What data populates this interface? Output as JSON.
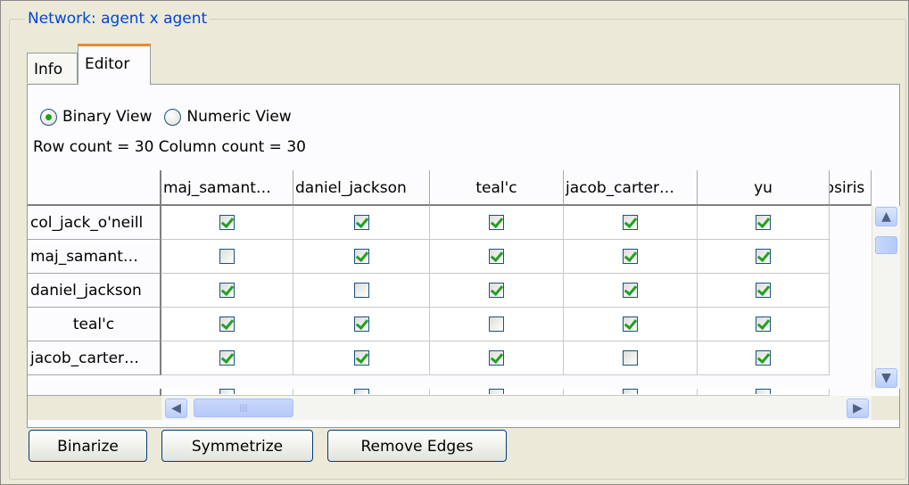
{
  "group_title": "Network: agent x agent",
  "tabs": [
    {
      "label": "Info"
    },
    {
      "label": "Editor"
    }
  ],
  "view_options": {
    "binary": "Binary View",
    "numeric": "Numeric View",
    "selected": "binary"
  },
  "count_line": "Row count = 30 Column count = 30",
  "columns": [
    "maj_samant…",
    "daniel_jackson",
    "teal'c",
    "jacob_carter…",
    "yu",
    "osiris"
  ],
  "rows": [
    {
      "label": "col_jack_o'neill",
      "checked": [
        true,
        true,
        true,
        true,
        true
      ]
    },
    {
      "label": "maj_samant…",
      "checked": [
        false,
        true,
        true,
        true,
        true
      ]
    },
    {
      "label": "daniel_jackson",
      "checked": [
        true,
        false,
        true,
        true,
        true
      ]
    },
    {
      "label": "teal'c",
      "checked": [
        true,
        true,
        false,
        true,
        true
      ]
    },
    {
      "label": "jacob_carter…",
      "checked": [
        true,
        true,
        true,
        false,
        true
      ]
    }
  ],
  "buttons": {
    "binarize": "Binarize",
    "symmetrize": "Symmetrize",
    "remove_edges": "Remove Edges"
  },
  "scroll_glyphs": {
    "up": "▲",
    "down": "▼",
    "left": "◀",
    "right": "▶",
    "grip": "|||"
  }
}
